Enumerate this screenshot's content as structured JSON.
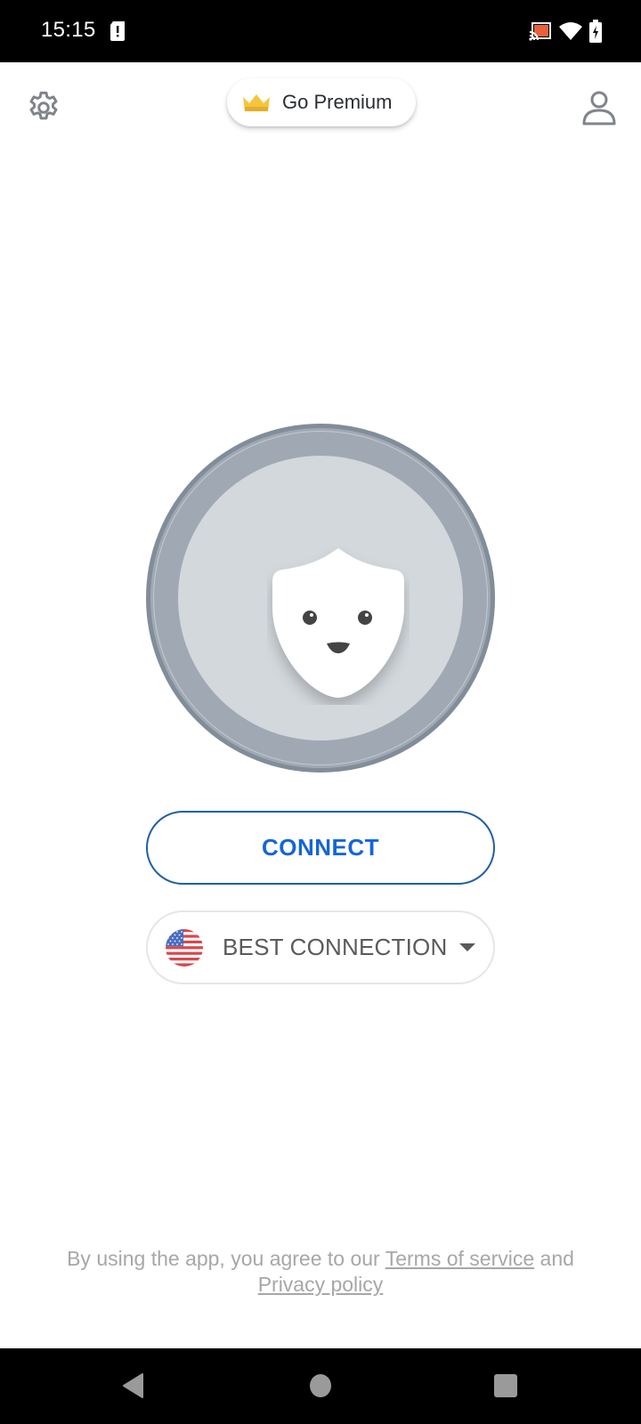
{
  "status_bar": {
    "time": "15:15",
    "left_icons": [
      "sim-alert-icon"
    ],
    "right_icons": [
      "cast-icon",
      "wifi-icon",
      "battery-charging-icon"
    ],
    "cast_color": "#e8603c"
  },
  "top_bar": {
    "settings_icon": "gear-icon",
    "premium_label": "Go Premium",
    "premium_icon": "crown-icon",
    "crown_color": "#f5c53c",
    "profile_icon": "user-icon"
  },
  "main": {
    "vpn_button_icon": "shield-mascot-icon",
    "vpn_state": "disconnected",
    "connect_label": "CONNECT",
    "connect_color": "#1565d8",
    "location": {
      "flag": "us-flag-icon",
      "label": "BEST CONNECTION",
      "dropdown_icon": "caret-down-icon"
    }
  },
  "footer": {
    "legal_prefix": "By using the app, you agree to our ",
    "terms_link": "Terms of service",
    "legal_and": " and",
    "privacy_link": "Privacy policy"
  },
  "nav_bar": {
    "buttons": [
      "back",
      "home",
      "recents"
    ]
  }
}
